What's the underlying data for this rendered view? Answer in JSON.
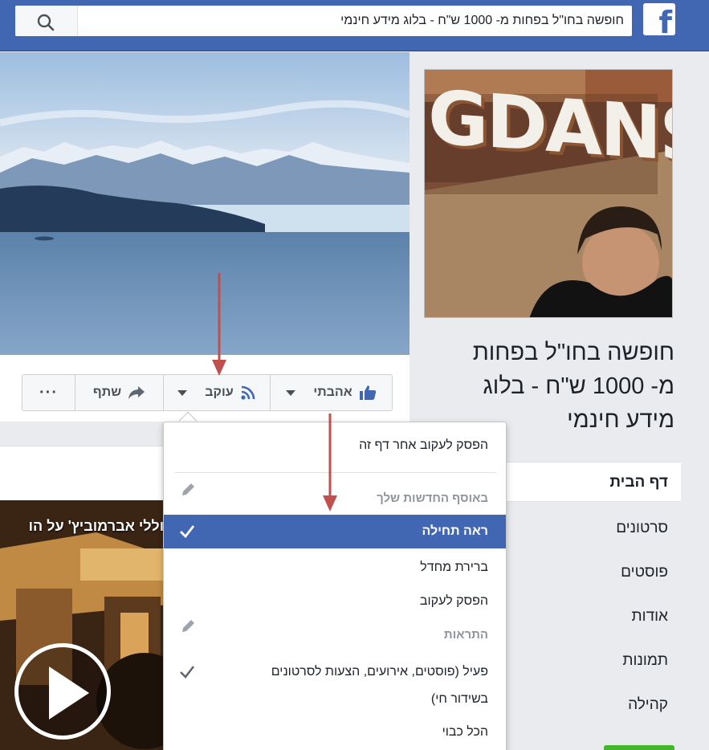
{
  "topbar": {
    "search_value": "חופשה בחו\"ל בפחות מ- 1000 ש\"ח - בלוג מידע חינמי",
    "logo_letter": "f"
  },
  "profile_picture": {
    "sign_text": "GDANSK"
  },
  "page": {
    "name_line1": "חופשה בחו\"ל בפחות",
    "name_line2": "מ- 1000 ש\"ח - בלוג",
    "name_line3": "מידע חינמי"
  },
  "actions": {
    "like_label": "אהבתי",
    "follow_label": "עוקב",
    "share_label": "שתף",
    "more_label": "···"
  },
  "nav": {
    "items": [
      {
        "label": "דף הבית"
      },
      {
        "label": "סרטונים"
      },
      {
        "label": "פוסטים"
      },
      {
        "label": "אודות"
      },
      {
        "label": "תמונות"
      },
      {
        "label": "קהילה"
      }
    ]
  },
  "follow_menu": {
    "unfollow_page": "הפסק לעקוב אחר דף זה",
    "newsfeed_header": "באוסף החדשות שלך",
    "see_first": "ראה תחילה",
    "default": "ברירת מחדל",
    "unfollow": "הפסק לעקוב",
    "notifications_header": "התראות",
    "active_line1": "פעיל (פוסטים, אירועים, הצעות לסרטונים",
    "active_line2": "בשידור חי)",
    "all_off": "הכל כבוי"
  },
  "video": {
    "title": "ז' וללי אברמוביץ' על הו"
  },
  "colors": {
    "brand_blue": "#4267b2",
    "arrow_red": "#c0504d",
    "like_blue": "#4267b2"
  }
}
